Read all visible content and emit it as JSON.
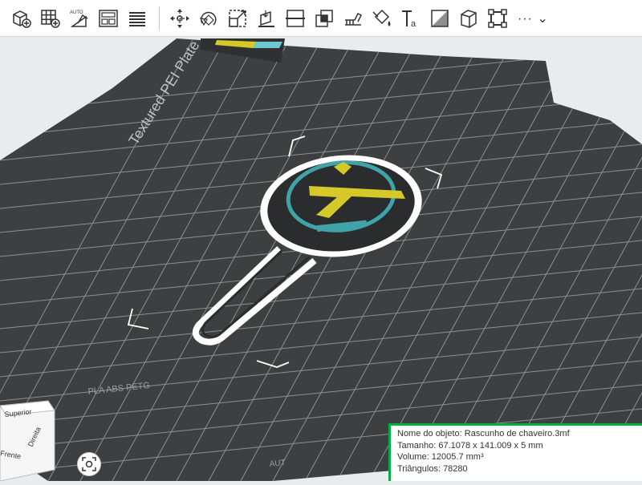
{
  "toolbar": {
    "items": [
      {
        "name": "add-object-icon"
      },
      {
        "name": "add-plate-icon"
      },
      {
        "name": "auto-orient-icon",
        "label": "AUTO"
      },
      {
        "name": "arrange-icon"
      },
      {
        "name": "split-layers-icon"
      },
      {
        "name": "move-icon"
      },
      {
        "name": "rotate-icon"
      },
      {
        "name": "scale-icon"
      },
      {
        "name": "lay-on-face-icon"
      },
      {
        "name": "cut-icon"
      },
      {
        "name": "boolean-icon"
      },
      {
        "name": "support-paint-icon"
      },
      {
        "name": "color-paint-icon"
      },
      {
        "name": "text-icon",
        "label": "Ta"
      },
      {
        "name": "seam-paint-icon"
      },
      {
        "name": "mesh-icon"
      },
      {
        "name": "measure-icon"
      }
    ],
    "more_label": "···"
  },
  "plate": {
    "label": "Textured PEI Plate",
    "filament_label": "PLA ABS PETG",
    "corner_label": "AUT"
  },
  "object_info": {
    "name": "Nome do objeto: Rascunho de chaveiro.3mf",
    "size": "Tamanho: 67.1078 x 141.009 x 5 mm",
    "volume": "Volume: 12005.7 mm³",
    "triangles": "Triângulos: 78280",
    "accent_color": "#00ae42"
  },
  "navcube": {
    "top": "Superior",
    "right": "Direita",
    "front": "Frente"
  },
  "colors": {
    "plate": "#3d3f41",
    "grid": "#8a8c8e",
    "filament_yellow": "#d4c928",
    "filament_teal": "#3fa3a9"
  }
}
